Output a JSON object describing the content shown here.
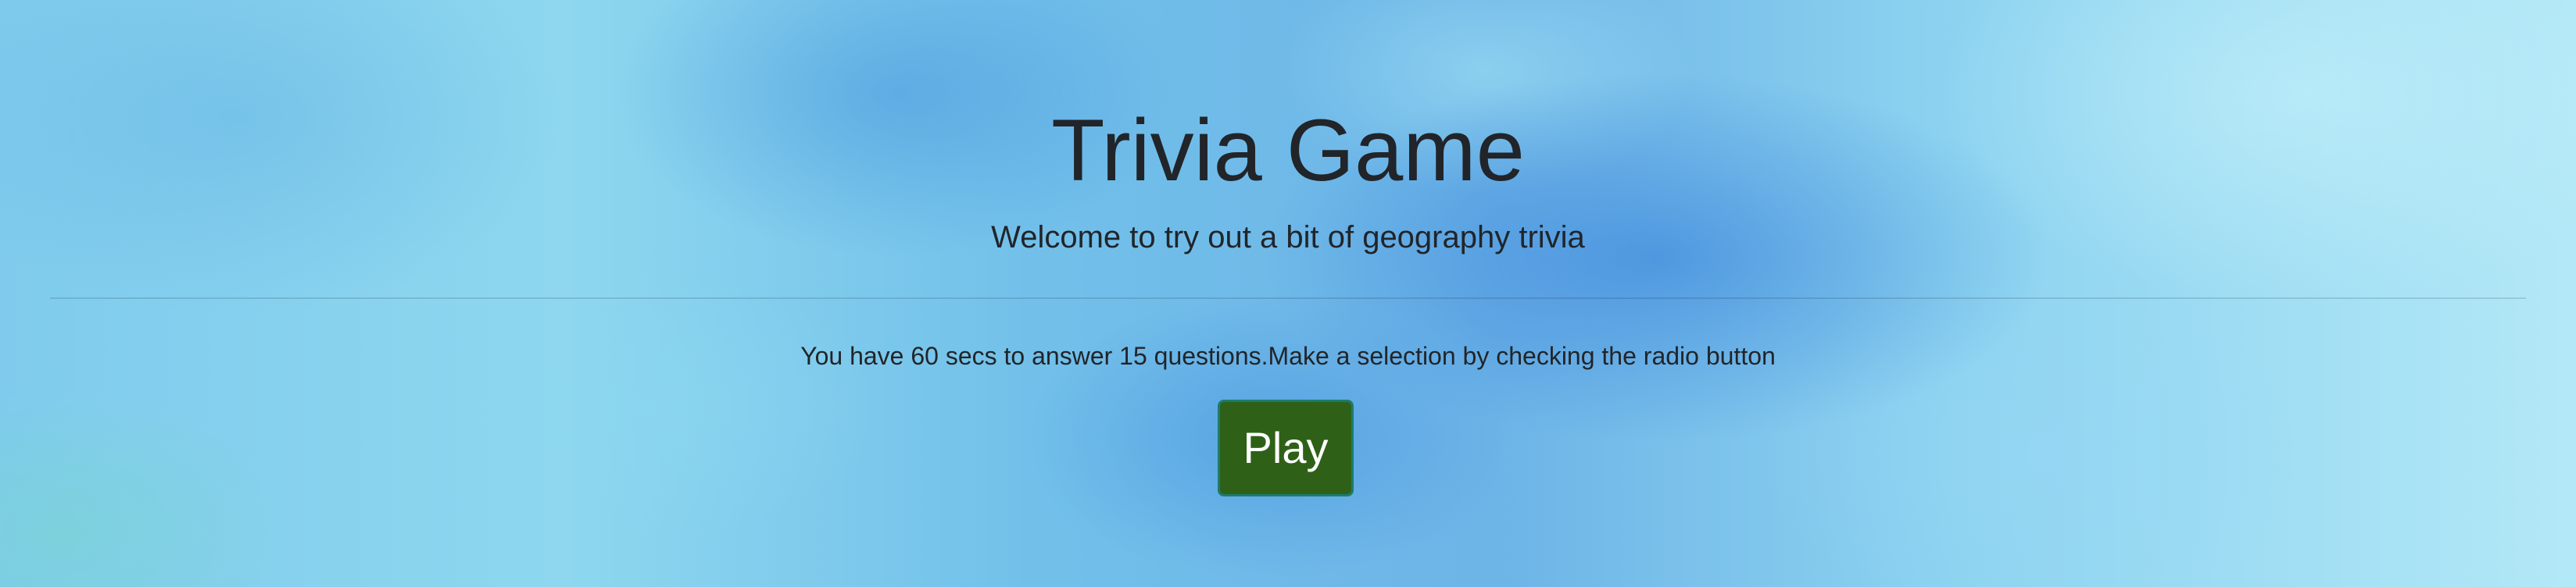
{
  "title": "Trivia Game",
  "subtitle": "Welcome to try out a bit of geography trivia",
  "instructions": "You have 60 secs to answer 15 questions.Make a selection by checking the radio button",
  "play_button": {
    "label": "Play"
  },
  "colors": {
    "button_bg": "#2e6117",
    "button_border": "#1e7b6b",
    "text": "#212529"
  }
}
